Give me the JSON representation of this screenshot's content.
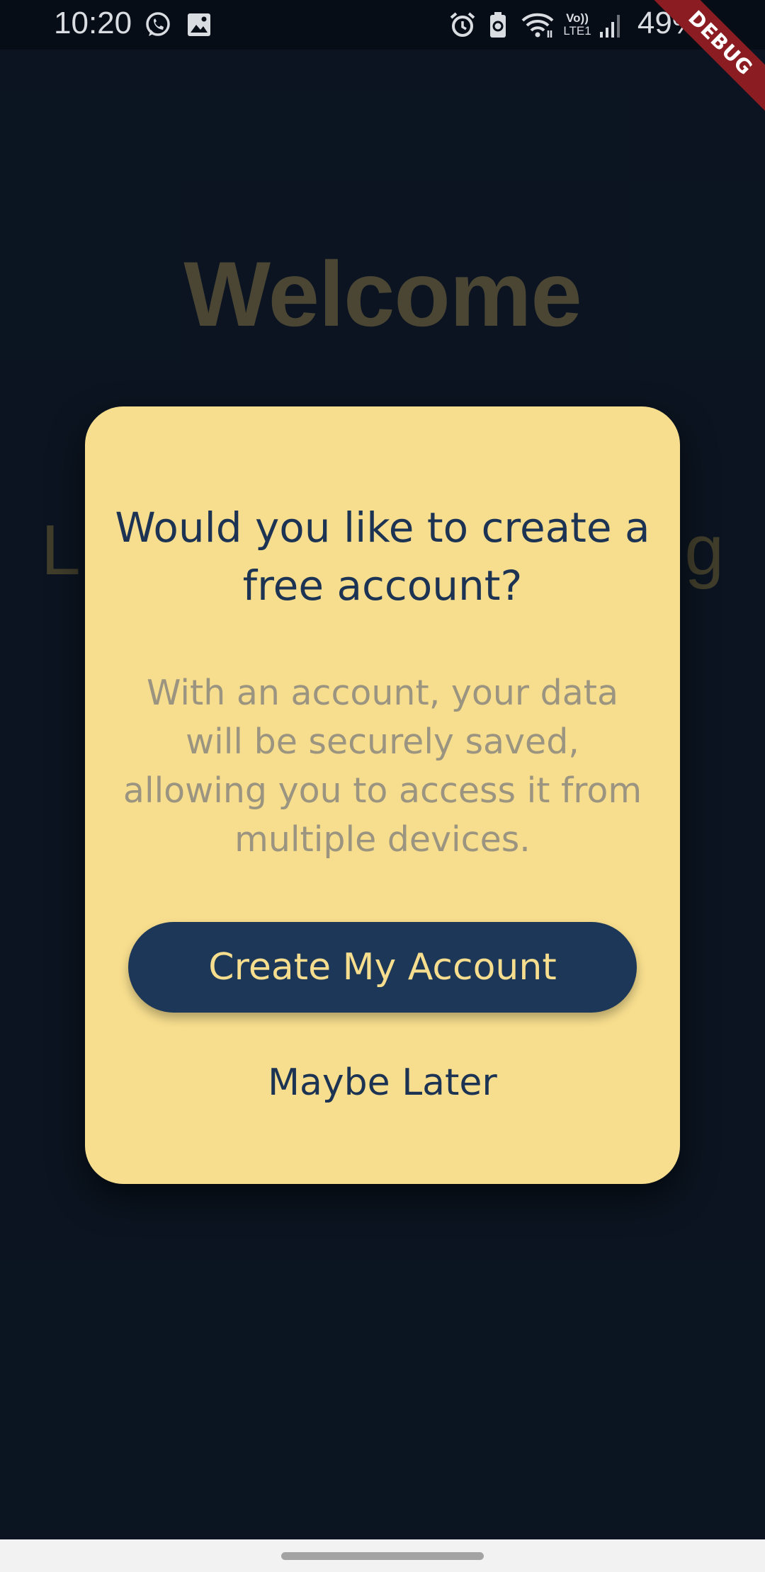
{
  "status_bar": {
    "time": "10:20",
    "battery_percent": "49%",
    "network_label": "Vo))\nLTE1",
    "icons": [
      "whatsapp-icon",
      "gallery-icon",
      "alarm-icon",
      "battery-saver-icon",
      "wifi-icon",
      "lte-icon",
      "signal-icon",
      "battery-icon"
    ]
  },
  "debug_banner": {
    "label": "DEBUG"
  },
  "background": {
    "title": "Welcome",
    "partial_left": "L",
    "partial_right": "g"
  },
  "dialog": {
    "title": "Would you like to create a free account?",
    "body": "With an account, your data will be securely saved, allowing you to access it from multiple devices.",
    "primary_button": "Create My Account",
    "secondary_button": "Maybe Later"
  },
  "colors": {
    "background": "#0d1726",
    "dialog_background": "#f7de8e",
    "primary_button": "#1c3757",
    "title_text": "#1c3354",
    "body_text": "#9a9480",
    "debug_banner": "#8a1c22"
  }
}
